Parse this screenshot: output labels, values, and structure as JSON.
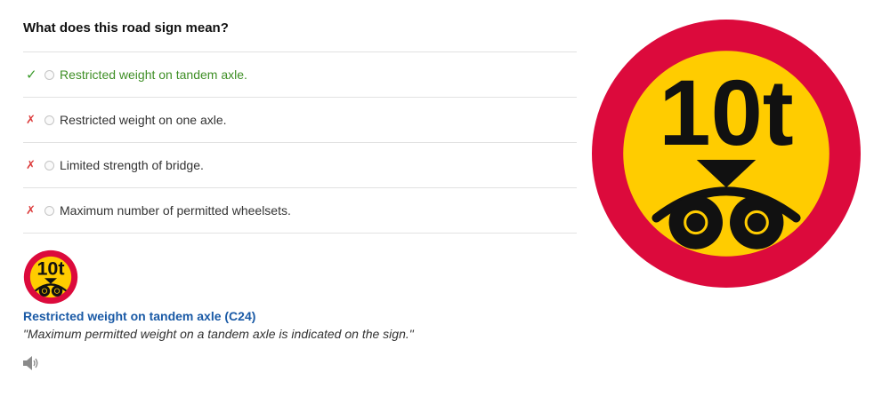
{
  "question": "What does this road sign mean?",
  "answers": [
    {
      "label": "Restricted weight on tandem axle.",
      "mark": "✓",
      "status": "correct"
    },
    {
      "label": "Restricted weight on one axle.",
      "mark": "✗",
      "status": "wrong"
    },
    {
      "label": "Limited strength of bridge.",
      "mark": "✗",
      "status": "wrong"
    },
    {
      "label": "Maximum number of permitted wheelsets.",
      "mark": "✗",
      "status": "wrong"
    }
  ],
  "explanation": {
    "title": "Restricted weight on tandem axle (C24)",
    "text": "\"Maximum permitted weight on a tandem axle is indicated on the sign.\""
  },
  "sign": {
    "text": "10t",
    "colors": {
      "border": "#dc0a3c",
      "fill": "#ffcc00",
      "symbol": "#111111"
    }
  },
  "icons": {
    "correct": "checkmark-icon",
    "wrong": "cross-icon",
    "audio": "speaker-icon"
  },
  "colors": {
    "correct_text": "#3f8f26",
    "wrong_mark": "#dc3b3b",
    "link": "#1a5aa6"
  }
}
